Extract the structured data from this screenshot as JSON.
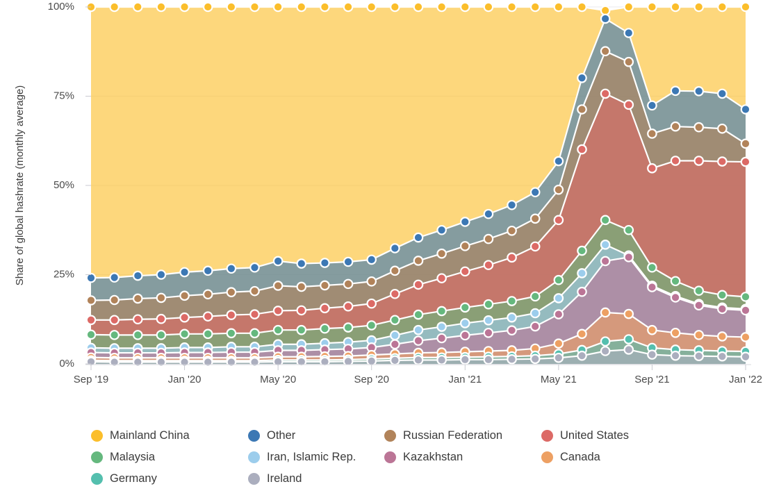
{
  "axes": {
    "y_title": "Share of global hashrate (monthly average)",
    "y_ticks": [
      "0%",
      "25%",
      "50%",
      "75%",
      "100%"
    ],
    "x_ticks": [
      "Sep '19",
      "Jan '20",
      "May '20",
      "Sep '20",
      "Jan '21",
      "May '21",
      "Sep '21",
      "Jan '22"
    ]
  },
  "legend": {
    "items": [
      {
        "label": "Mainland China",
        "color": "#FBBE2B"
      },
      {
        "label": "Other",
        "color": "#3C78B4"
      },
      {
        "label": "Russian Federation",
        "color": "#B1835A"
      },
      {
        "label": "United States",
        "color": "#DC6A66"
      },
      {
        "label": "Malaysia",
        "color": "#65B87E"
      },
      {
        "label": "Iran, Islamic Rep.",
        "color": "#9CCDEC"
      },
      {
        "label": "Kazakhstan",
        "color": "#BB7596"
      },
      {
        "label": "Canada",
        "color": "#EDA063"
      },
      {
        "label": "Germany",
        "color": "#54BFAE"
      },
      {
        "label": "Ireland",
        "color": "#ABAEBE"
      }
    ]
  },
  "chart_data": {
    "type": "area",
    "stacked": true,
    "title": "",
    "xlabel": "",
    "ylabel": "Share of global hashrate (monthly average)",
    "ylim": [
      0,
      100
    ],
    "grid": true,
    "legend_position": "bottom",
    "x": [
      "Sep '19",
      "Oct '19",
      "Nov '19",
      "Dec '19",
      "Jan '20",
      "Feb '20",
      "Mar '20",
      "Apr '20",
      "May '20",
      "Jun '20",
      "Jul '20",
      "Aug '20",
      "Sep '20",
      "Oct '20",
      "Nov '20",
      "Dec '20",
      "Jan '21",
      "Feb '21",
      "Mar '21",
      "Apr '21",
      "May '21",
      "Jun '21",
      "Jul '21",
      "Aug '21",
      "Sep '21",
      "Oct '21",
      "Nov '21",
      "Dec '21",
      "Jan '22"
    ],
    "stack_order_bottom_to_top": [
      "Ireland",
      "Germany",
      "Canada",
      "Kazakhstan",
      "Iran, Islamic Rep.",
      "Malaysia",
      "United States",
      "Russian Federation",
      "Other",
      "Mainland China"
    ],
    "series": [
      {
        "name": "Ireland",
        "color": "#ABAEBE",
        "values": [
          0.6,
          0.5,
          0.5,
          0.5,
          0.5,
          0.5,
          0.5,
          0.5,
          0.6,
          0.6,
          0.6,
          0.7,
          0.8,
          1.0,
          1.1,
          1.1,
          1.2,
          1.2,
          1.3,
          1.4,
          1.7,
          2.3,
          3.6,
          4.0,
          2.6,
          2.3,
          2.2,
          2.1,
          2.0
        ]
      },
      {
        "name": "Germany",
        "color": "#54BFAE",
        "values": [
          0.4,
          0.4,
          0.4,
          0.4,
          0.4,
          0.4,
          0.4,
          0.4,
          0.5,
          0.5,
          0.5,
          0.5,
          0.6,
          0.6,
          0.7,
          0.7,
          0.7,
          0.8,
          0.8,
          0.9,
          1.1,
          1.6,
          2.7,
          2.9,
          1.9,
          1.7,
          1.6,
          1.5,
          1.5
        ]
      },
      {
        "name": "Canada",
        "color": "#EDA063",
        "values": [
          0.8,
          0.8,
          0.8,
          0.8,
          0.8,
          0.8,
          0.8,
          0.8,
          0.9,
          0.9,
          1.0,
          1.0,
          1.1,
          1.2,
          1.3,
          1.4,
          1.5,
          1.6,
          1.7,
          2.0,
          2.9,
          4.5,
          8.1,
          7.1,
          5.0,
          4.7,
          4.3,
          4.1,
          4.0
        ]
      },
      {
        "name": "Kazakhstan",
        "color": "#BB7596",
        "values": [
          1.4,
          1.4,
          1.4,
          1.4,
          1.5,
          1.5,
          1.6,
          1.6,
          1.8,
          1.8,
          1.9,
          2.0,
          2.1,
          2.7,
          3.4,
          4.0,
          4.6,
          5.1,
          5.6,
          6.2,
          8.2,
          11.8,
          14.4,
          15.9,
          12.0,
          9.9,
          8.3,
          7.7,
          7.5
        ]
      },
      {
        "name": "Iran, Islamic Rep.",
        "color": "#9CCDEC",
        "values": [
          1.3,
          1.3,
          1.3,
          1.3,
          1.4,
          1.4,
          1.5,
          1.5,
          1.7,
          1.7,
          1.8,
          1.9,
          2.0,
          2.5,
          3.0,
          3.2,
          3.4,
          3.5,
          3.6,
          3.7,
          4.5,
          5.2,
          4.6,
          0.5,
          0.4,
          0.4,
          0.4,
          0.4,
          0.4
        ]
      },
      {
        "name": "Malaysia",
        "color": "#65B87E",
        "values": [
          3.7,
          3.7,
          3.7,
          3.7,
          3.8,
          3.8,
          3.8,
          3.8,
          4.0,
          4.0,
          4.1,
          4.1,
          4.2,
          4.3,
          4.3,
          4.4,
          4.4,
          4.5,
          4.6,
          4.7,
          5.1,
          6.3,
          6.9,
          7.1,
          5.1,
          4.2,
          3.7,
          3.5,
          3.4
        ]
      },
      {
        "name": "United States",
        "color": "#DC6A66",
        "values": [
          4.1,
          4.2,
          4.4,
          4.5,
          4.6,
          4.9,
          5.1,
          5.3,
          5.4,
          5.5,
          5.7,
          5.9,
          6.1,
          7.3,
          8.4,
          9.2,
          10.1,
          11.0,
          12.2,
          14.0,
          16.8,
          28.4,
          35.4,
          35.1,
          27.8,
          33.7,
          36.4,
          37.4,
          37.8
        ]
      },
      {
        "name": "Russian Federation",
        "color": "#B1835A",
        "values": [
          5.5,
          5.6,
          5.8,
          5.9,
          6.1,
          6.2,
          6.4,
          6.5,
          7.0,
          6.6,
          6.4,
          6.3,
          6.2,
          6.5,
          6.7,
          6.9,
          7.1,
          7.3,
          7.5,
          7.8,
          8.5,
          11.2,
          11.9,
          12.0,
          9.7,
          9.6,
          9.4,
          9.2,
          5.1
        ]
      },
      {
        "name": "Other",
        "color": "#3C78B4",
        "values": [
          6.3,
          6.3,
          6.4,
          6.5,
          6.6,
          6.6,
          6.6,
          6.6,
          6.9,
          6.5,
          6.3,
          6.2,
          6.1,
          6.3,
          6.5,
          6.6,
          6.8,
          7.0,
          7.2,
          7.4,
          8.0,
          8.8,
          9.1,
          8.1,
          7.9,
          10.0,
          10.1,
          9.8,
          9.6
        ]
      },
      {
        "name": "Mainland China",
        "color": "#FBBE2B",
        "values": [
          75.9,
          75.8,
          75.3,
          75.0,
          74.3,
          73.9,
          73.3,
          73.0,
          71.2,
          71.9,
          71.7,
          71.4,
          70.8,
          67.6,
          64.6,
          62.5,
          60.2,
          58.0,
          55.5,
          51.9,
          43.2,
          19.9,
          2.3,
          7.3,
          27.6,
          23.5,
          23.6,
          24.3,
          28.7
        ]
      }
    ]
  }
}
